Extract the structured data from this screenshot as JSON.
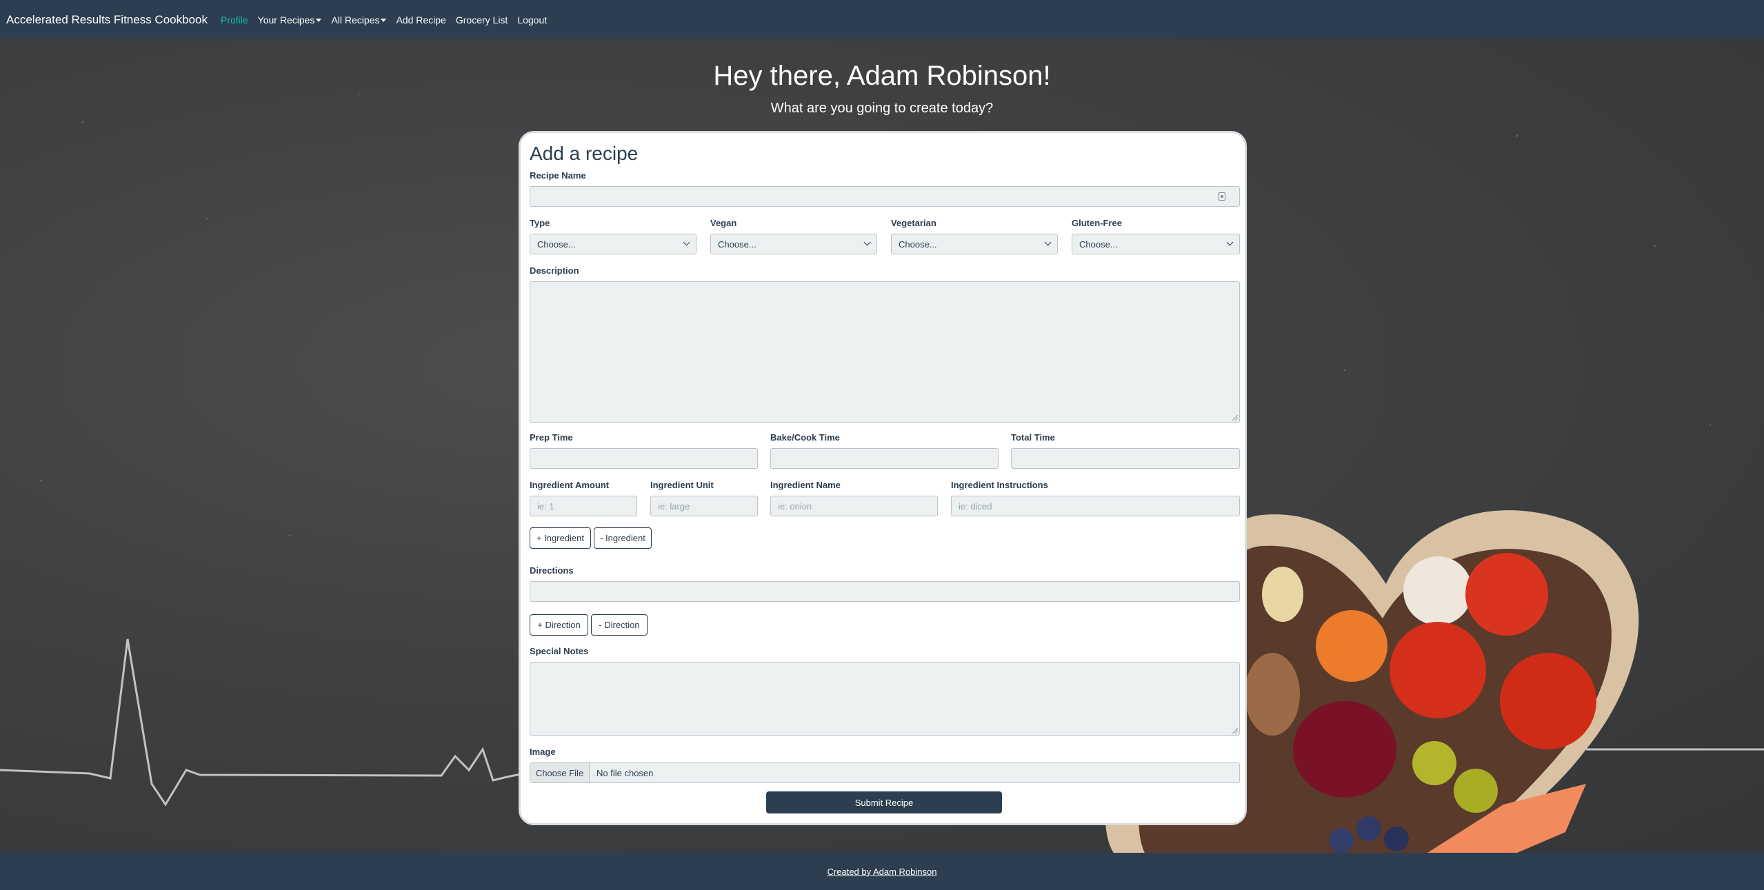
{
  "navbar": {
    "brand": "Accelerated Results Fitness Cookbook",
    "items": [
      {
        "label": "Profile",
        "active": true,
        "dropdown": false
      },
      {
        "label": "Your Recipes",
        "active": false,
        "dropdown": true
      },
      {
        "label": "All Recipes",
        "active": false,
        "dropdown": true
      },
      {
        "label": "Add Recipe",
        "active": false,
        "dropdown": false
      },
      {
        "label": "Grocery List",
        "active": false,
        "dropdown": false
      },
      {
        "label": "Logout",
        "active": false,
        "dropdown": false
      }
    ]
  },
  "greeting": {
    "title": "Hey there, Adam Robinson!",
    "subtitle": "What are you going to create today?"
  },
  "form": {
    "heading": "Add a recipe",
    "recipe_name_label": "Recipe Name",
    "recipe_name_value": "",
    "type_label": "Type",
    "type_value": "Choose...",
    "vegan_label": "Vegan",
    "vegan_value": "Choose...",
    "vegetarian_label": "Vegetarian",
    "vegetarian_value": "Choose...",
    "gluten_free_label": "Gluten-Free",
    "gluten_free_value": "Choose...",
    "description_label": "Description",
    "prep_time_label": "Prep Time",
    "cook_time_label": "Bake/Cook Time",
    "total_time_label": "Total Time",
    "ingredient_amount_label": "Ingredient Amount",
    "ingredient_amount_placeholder": "ie: 1",
    "ingredient_unit_label": "Ingredient Unit",
    "ingredient_unit_placeholder": "ie: large",
    "ingredient_name_label": "Ingredient Name",
    "ingredient_name_placeholder": "ie: onion",
    "ingredient_instructions_label": "Ingredient Instructions",
    "ingredient_instructions_placeholder": "ie: diced",
    "add_ingredient": "+ Ingredient",
    "remove_ingredient": "- Ingredient",
    "directions_label": "Directions",
    "add_direction": "+ Direction",
    "remove_direction": "- Direction",
    "special_notes_label": "Special Notes",
    "image_label": "Image",
    "choose_file": "Choose File",
    "no_file": "No file chosen",
    "submit": "Submit Recipe"
  },
  "footer": {
    "credit": "Created by Adam Robinson"
  },
  "colors": {
    "navbar": "#2c3e50",
    "active_link": "#18bc9c",
    "input_bg": "#ecf0f1"
  }
}
